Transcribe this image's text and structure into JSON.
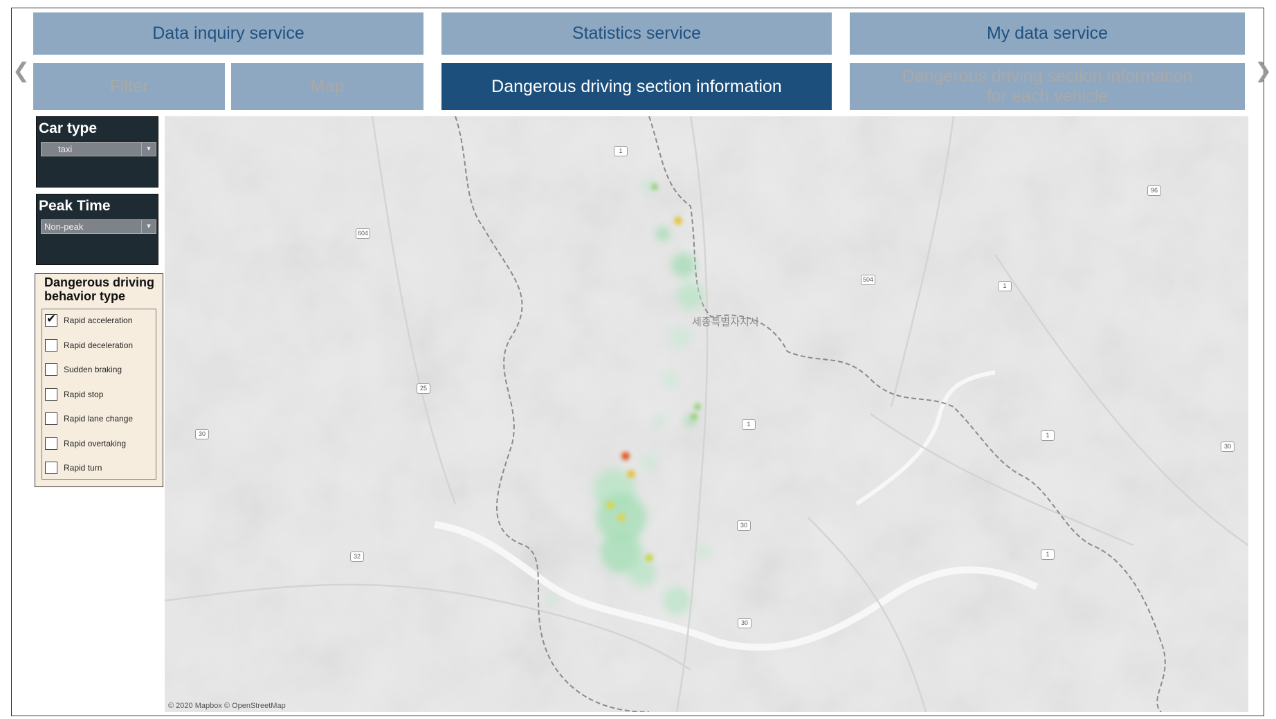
{
  "tabs_top": [
    {
      "label": "Data inquiry service"
    },
    {
      "label": "Statistics service"
    },
    {
      "label": "My data service"
    }
  ],
  "tabs_sub": [
    {
      "label": "Filter"
    },
    {
      "label": "Map"
    },
    {
      "label": "Dangerous driving section information"
    },
    {
      "label": "Dangerous driving section information\nfor each vehicle"
    }
  ],
  "filters": {
    "car_type": {
      "title": "Car type",
      "value": "taxi"
    },
    "peak_time": {
      "title": "Peak Time",
      "value": "Non-peak"
    }
  },
  "behavior": {
    "title_line1": "Dangerous driving",
    "title_line2": "behavior type",
    "items": [
      {
        "label": "Rapid acceleration",
        "checked": true
      },
      {
        "label": "Rapid deceleration",
        "checked": false
      },
      {
        "label": "Sudden braking",
        "checked": false
      },
      {
        "label": "Rapid stop",
        "checked": false
      },
      {
        "label": "Rapid lane change",
        "checked": false
      },
      {
        "label": "Rapid overtaking",
        "checked": false
      },
      {
        "label": "Rapid turn",
        "checked": false
      }
    ]
  },
  "map": {
    "city_label": "세종특별자치시",
    "attribution": "© 2020 Mapbox © OpenStreetMap",
    "route_shields": [
      "1",
      "604",
      "96",
      "504",
      "1",
      "25",
      "1",
      "30",
      "30",
      "1",
      "30",
      "32",
      "1",
      "30"
    ]
  },
  "colors": {
    "tab_bg": "#8fa8c2",
    "tab_active_bg": "#1d4f7c",
    "tab_text": "#1f5180",
    "panel_bg": "#1f2b33",
    "behavior_bg": "#f7eddf"
  }
}
